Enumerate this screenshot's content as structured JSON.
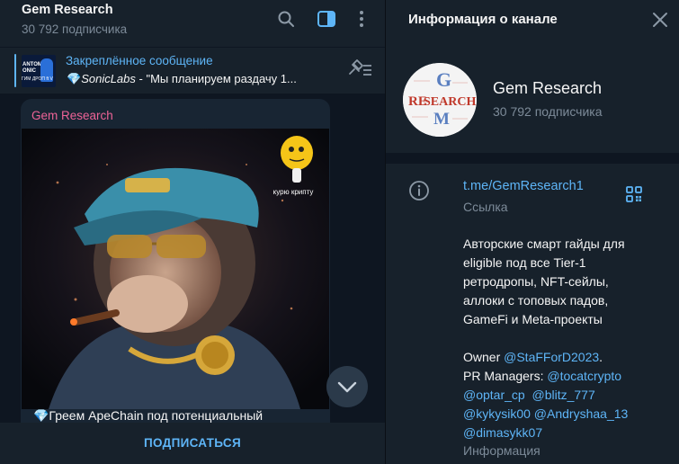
{
  "chat": {
    "title": "Gem Research",
    "subscribers": "30 792 подписчика",
    "icons": [
      "search-icon",
      "sidebar-toggle-icon",
      "more-vertical-icon"
    ],
    "pinned": {
      "label": "Закреплённое сообщение",
      "emoji": "💎",
      "author": "SonicLabs",
      "text": " - \"Мы планируем раздачу 1...",
      "thumb_line1": "ANTOM",
      "thumb_line2": "ONIC",
      "thumb_line3": "ГИМ ДРОП ft V",
      "icon": "unpin-list-icon"
    },
    "message": {
      "author": "Gem Research",
      "sticker_caption": "курю крипту",
      "caption": "💎Греем ApeChain под потенциальный"
    },
    "subscribe_label": "ПОДПИСАТЬСЯ"
  },
  "info": {
    "title": "Информация о канале",
    "channel_name": "Gem Research",
    "subscribers": "30 792 подписчика",
    "avatar_letters": [
      "G",
      "RE",
      "SEARCH",
      "M"
    ],
    "link": "t.me/GemResearch1",
    "link_caption": "Ссылка",
    "description_lines": [
      "Авторские смарт гайды для",
      "eligible под все Tier-1",
      "ретродропы, NFT-сейлы,",
      "аллоки с топовых падов,",
      "GameFi и Meta-проекты"
    ],
    "owner_label": "Owner ",
    "owner_mention": "@StaFForD2023",
    "owner_suffix": ".",
    "managers_label": "PR Managers: ",
    "managers": [
      "@tocatcrypto",
      "@optar_cp",
      "@blitz_777",
      "@kykysik00",
      "@Andryshaa_13",
      "@dimasykk07"
    ],
    "description_caption": "Информация"
  },
  "colors": {
    "accent": "#5eb5f7",
    "author": "#ee6397",
    "panel": "#17212b",
    "background": "#0e1621",
    "muted": "#7d8b99"
  }
}
